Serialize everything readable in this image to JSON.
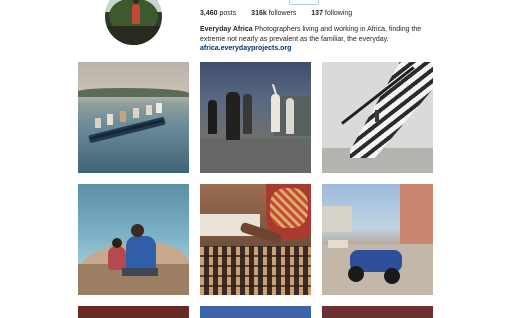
{
  "profile": {
    "posts_count": "3,460",
    "posts_label": "posts",
    "followers_count": "316k",
    "followers_label": "followers",
    "following_count": "137",
    "following_label": "following",
    "bio_name": "Everyday Africa",
    "bio_text": "Photographers living and working in Africa, finding the extreme not nearly as prevalent as the familiar, the everyday.",
    "bio_link": "africa.everydayprojects.org"
  },
  "colors": {
    "link": "#003569",
    "text": "#262626",
    "follow_border": "#b8cfe4"
  },
  "posts": [
    {
      "subject": "canoe-on-lake-photo"
    },
    {
      "subject": "night-street-people-photo"
    },
    {
      "subject": "staircase-photo"
    },
    {
      "subject": "boys-by-water-photo"
    },
    {
      "subject": "hands-with-fabric-photo"
    },
    {
      "subject": "motorbikes-street-photo"
    },
    {
      "subject": "partial-photo-red"
    },
    {
      "subject": "partial-photo-blue"
    },
    {
      "subject": "partial-photo-maroon"
    }
  ]
}
